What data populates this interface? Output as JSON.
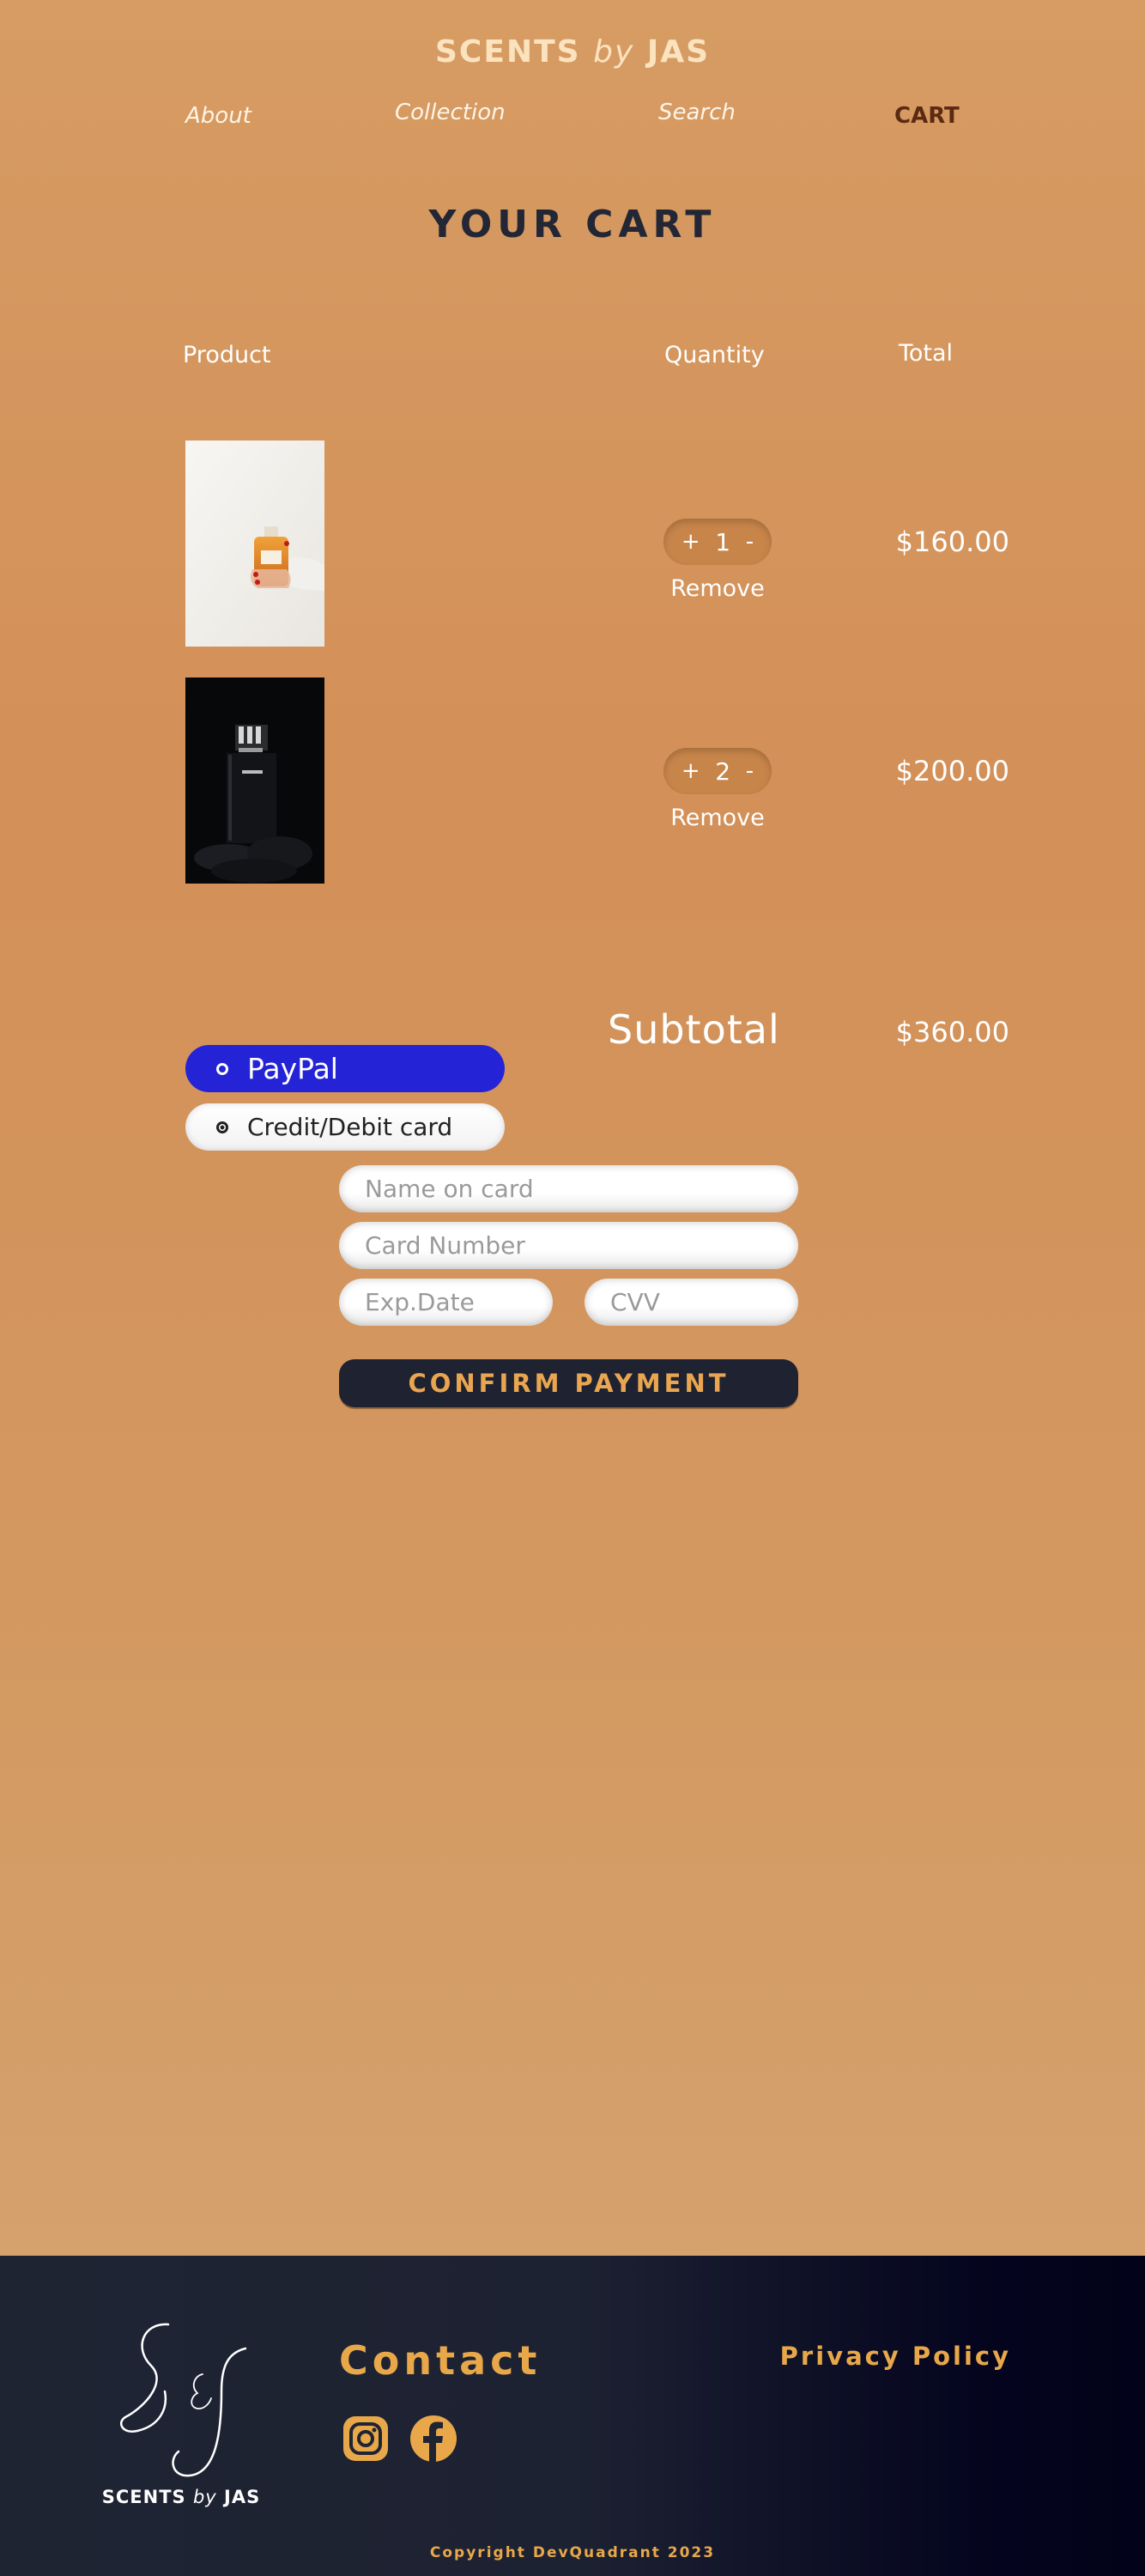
{
  "header": {
    "brand_main": "SCENTS",
    "brand_by": "by",
    "brand_name": "JAS",
    "nav": {
      "about": "About",
      "collection": "Collection",
      "search": "Search",
      "cart": "CART"
    }
  },
  "cart": {
    "title": "YOUR CART",
    "columns": {
      "product": "Product",
      "quantity": "Quantity",
      "total": "Total"
    },
    "items": [
      {
        "image": "perfume-bottle-hand-photo",
        "plus": "+",
        "quantity": "1",
        "minus": "-",
        "remove": "Remove",
        "total": "$160.00"
      },
      {
        "image": "prada-bottle-dark-photo",
        "plus": "+",
        "quantity": "2",
        "minus": "-",
        "remove": "Remove",
        "total": "$200.00"
      }
    ],
    "subtotal_label": "Subtotal",
    "subtotal_value": "$360.00"
  },
  "payment": {
    "paypal_label": "PayPal",
    "card_label": "Credit/Debit card",
    "selected": "Credit/Debit card",
    "fields": {
      "name_placeholder": "Name on card",
      "number_placeholder": "Card Number",
      "exp_placeholder": "Exp.Date",
      "cvv_placeholder": "CVV"
    },
    "confirm_label": "CONFIRM PAYMENT",
    "colors": {
      "paypal": "#2424d6",
      "confirm_bg": "#1e2231",
      "confirm_text": "#e9a54f"
    }
  },
  "footer": {
    "logo_main": "SCENTS",
    "logo_by": "by",
    "logo_name": "JAS",
    "contact": "Contact",
    "social_icons": [
      "instagram-icon",
      "facebook-icon"
    ],
    "privacy": "Privacy Policy",
    "copyright": "Copyright DevQuadrant 2023",
    "accent": "#e8a84a"
  }
}
